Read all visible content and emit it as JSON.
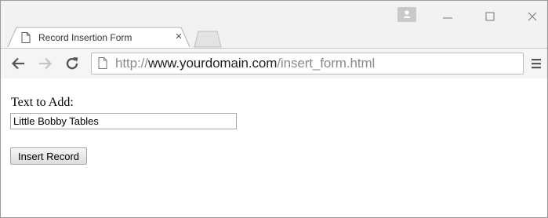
{
  "browser": {
    "tab": {
      "title": "Record Insertion Form",
      "icon": "page-icon",
      "close_glyph": "×"
    },
    "window_controls": [
      "profile-icon",
      "minimize-icon",
      "maximize-icon",
      "close-icon"
    ],
    "toolbar": {
      "url_scheme": "http://",
      "url_domain": "www.yourdomain.com",
      "url_path": "/insert_form.html",
      "icons": [
        "back-arrow-icon",
        "forward-arrow-icon",
        "reload-icon",
        "page-icon",
        "menu-icon"
      ]
    }
  },
  "page": {
    "form": {
      "label": "Text to Add:",
      "input_value": "Little Bobby Tables",
      "submit_label": "Insert Record"
    }
  },
  "colors": {
    "chrome_bg": "#f2f2f2",
    "toolbar_bg": "#f5f5f5",
    "url_dim": "#8a8a8a",
    "url_domain": "#222222"
  }
}
